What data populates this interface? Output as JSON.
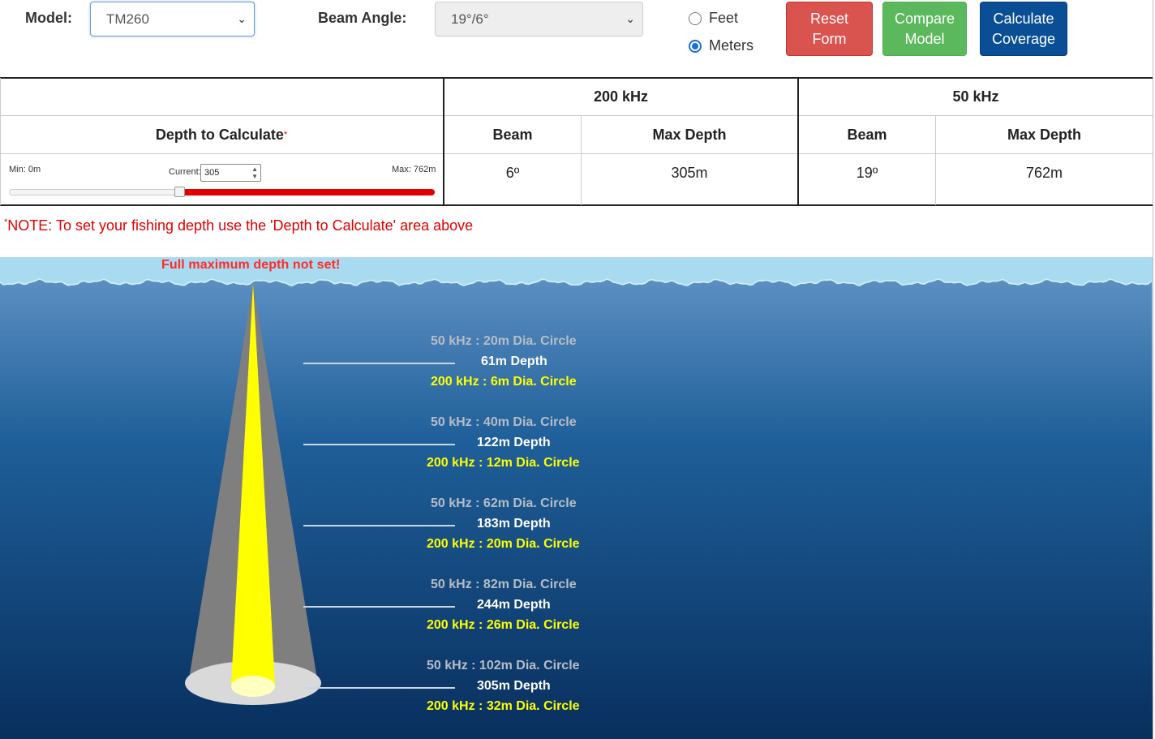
{
  "controls": {
    "model_label": "Model:",
    "model_value": "TM260",
    "beam_label": "Beam Angle:",
    "beam_value": "19°/6°",
    "units": [
      {
        "label": "Feet",
        "selected": false
      },
      {
        "label": "Meters",
        "selected": true
      }
    ],
    "buttons": {
      "reset_line1": "Reset",
      "reset_line2": "Form",
      "compare_line1": "Compare",
      "compare_line2": "Model",
      "calc_line1": "Calculate",
      "calc_line2": "Coverage"
    }
  },
  "table": {
    "freq1": "200 kHz",
    "freq2": "50 kHz",
    "depth_header": "Depth to Calculate",
    "asterisk": "*",
    "beam_header": "Beam",
    "max_depth_header": "Max Depth",
    "min_label": "Min: 0m",
    "current_label": "Current:",
    "current_value": "305",
    "max_label": "Max: 762m",
    "slider": {
      "min": 0,
      "max": 762,
      "current": 305
    },
    "f1_beam": "6º",
    "f1_max_depth": "305m",
    "f2_beam": "19º",
    "f2_max_depth": "762m"
  },
  "note": {
    "asterisk": "*",
    "text": "NOTE: To set your fishing depth use the 'Depth to Calculate' area above"
  },
  "scene": {
    "warning": "Full maximum depth not set!",
    "colors": {
      "surface": "#a9dbf0",
      "water_top": "#5b8fc2",
      "water_bottom": "#082f5e",
      "beam_50khz": "#7f7f7f",
      "beam_200khz": "#ffff00",
      "label_warning": "#ff2a2a"
    },
    "markers": [
      {
        "f2": "50 kHz : 20m Dia. Circle",
        "depth": "61m Depth",
        "f1": "200 kHz : 6m Dia. Circle"
      },
      {
        "f2": "50 kHz : 40m Dia. Circle",
        "depth": "122m Depth",
        "f1": "200 kHz : 12m Dia. Circle"
      },
      {
        "f2": "50 kHz : 62m Dia. Circle",
        "depth": "183m Depth",
        "f1": "200 kHz : 20m Dia. Circle"
      },
      {
        "f2": "50 kHz : 82m Dia. Circle",
        "depth": "244m Depth",
        "f1": "200 kHz : 26m Dia. Circle"
      },
      {
        "f2": "50 kHz : 102m Dia. Circle",
        "depth": "305m Depth",
        "f1": "200 kHz : 32m Dia. Circle"
      }
    ]
  }
}
